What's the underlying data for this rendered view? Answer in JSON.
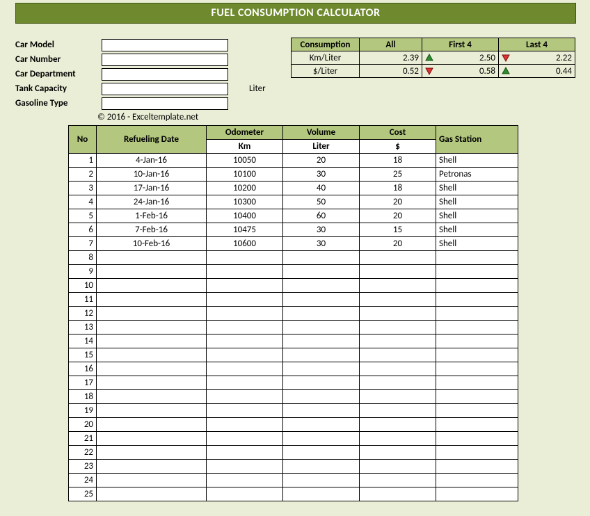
{
  "title": "FUEL CONSUMPTION CALCULATOR",
  "form": {
    "labels": {
      "model": "Car Model",
      "number": "Car Number",
      "dept": "Car Department",
      "tank": "Tank Capacity",
      "fuel": "Gasoline Type"
    },
    "values": {
      "model": "",
      "number": "",
      "dept": "",
      "tank": "",
      "fuel": ""
    },
    "tank_unit": "Liter"
  },
  "summary": {
    "headers": {
      "c0": "Consumption",
      "c1": "All",
      "c2": "First 4",
      "c3": "Last 4"
    },
    "rows": [
      {
        "metric": "Km/Liter",
        "all": "2.39",
        "first4": "2.50",
        "first4_dir": "up",
        "last4": "2.22",
        "last4_dir": "down"
      },
      {
        "metric": "$/Liter",
        "all": "0.52",
        "first4": "0.58",
        "first4_dir": "down",
        "last4": "0.44",
        "last4_dir": "up"
      }
    ]
  },
  "copyright": "© 2016 - Exceltemplate.net",
  "grid": {
    "headers": {
      "no": "No",
      "date": "Refueling Date",
      "odo": "Odometer",
      "odo_unit": "Km",
      "vol": "Volume",
      "vol_unit": "Liter",
      "cost": "Cost",
      "cost_unit": "$",
      "station": "Gas Station"
    },
    "rows": [
      {
        "no": 1,
        "date": "4-Jan-16",
        "odo": "10050",
        "vol": "20",
        "cost": "18",
        "station": "Shell"
      },
      {
        "no": 2,
        "date": "10-Jan-16",
        "odo": "10100",
        "vol": "30",
        "cost": "25",
        "station": "Petronas"
      },
      {
        "no": 3,
        "date": "17-Jan-16",
        "odo": "10200",
        "vol": "40",
        "cost": "18",
        "station": "Shell"
      },
      {
        "no": 4,
        "date": "24-Jan-16",
        "odo": "10300",
        "vol": "50",
        "cost": "20",
        "station": "Shell"
      },
      {
        "no": 5,
        "date": "1-Feb-16",
        "odo": "10400",
        "vol": "60",
        "cost": "20",
        "station": "Shell"
      },
      {
        "no": 6,
        "date": "7-Feb-16",
        "odo": "10475",
        "vol": "30",
        "cost": "15",
        "station": "Shell"
      },
      {
        "no": 7,
        "date": "10-Feb-16",
        "odo": "10600",
        "vol": "30",
        "cost": "20",
        "station": "Shell"
      },
      {
        "no": 8,
        "date": "",
        "odo": "",
        "vol": "",
        "cost": "",
        "station": ""
      },
      {
        "no": 9,
        "date": "",
        "odo": "",
        "vol": "",
        "cost": "",
        "station": ""
      },
      {
        "no": 10,
        "date": "",
        "odo": "",
        "vol": "",
        "cost": "",
        "station": ""
      },
      {
        "no": 11,
        "date": "",
        "odo": "",
        "vol": "",
        "cost": "",
        "station": ""
      },
      {
        "no": 12,
        "date": "",
        "odo": "",
        "vol": "",
        "cost": "",
        "station": ""
      },
      {
        "no": 13,
        "date": "",
        "odo": "",
        "vol": "",
        "cost": "",
        "station": ""
      },
      {
        "no": 14,
        "date": "",
        "odo": "",
        "vol": "",
        "cost": "",
        "station": ""
      },
      {
        "no": 15,
        "date": "",
        "odo": "",
        "vol": "",
        "cost": "",
        "station": ""
      },
      {
        "no": 16,
        "date": "",
        "odo": "",
        "vol": "",
        "cost": "",
        "station": ""
      },
      {
        "no": 17,
        "date": "",
        "odo": "",
        "vol": "",
        "cost": "",
        "station": ""
      },
      {
        "no": 18,
        "date": "",
        "odo": "",
        "vol": "",
        "cost": "",
        "station": ""
      },
      {
        "no": 19,
        "date": "",
        "odo": "",
        "vol": "",
        "cost": "",
        "station": ""
      },
      {
        "no": 20,
        "date": "",
        "odo": "",
        "vol": "",
        "cost": "",
        "station": ""
      },
      {
        "no": 21,
        "date": "",
        "odo": "",
        "vol": "",
        "cost": "",
        "station": ""
      },
      {
        "no": 22,
        "date": "",
        "odo": "",
        "vol": "",
        "cost": "",
        "station": ""
      },
      {
        "no": 23,
        "date": "",
        "odo": "",
        "vol": "",
        "cost": "",
        "station": ""
      },
      {
        "no": 24,
        "date": "",
        "odo": "",
        "vol": "",
        "cost": "",
        "station": ""
      },
      {
        "no": 25,
        "date": "",
        "odo": "",
        "vol": "",
        "cost": "",
        "station": ""
      }
    ]
  }
}
